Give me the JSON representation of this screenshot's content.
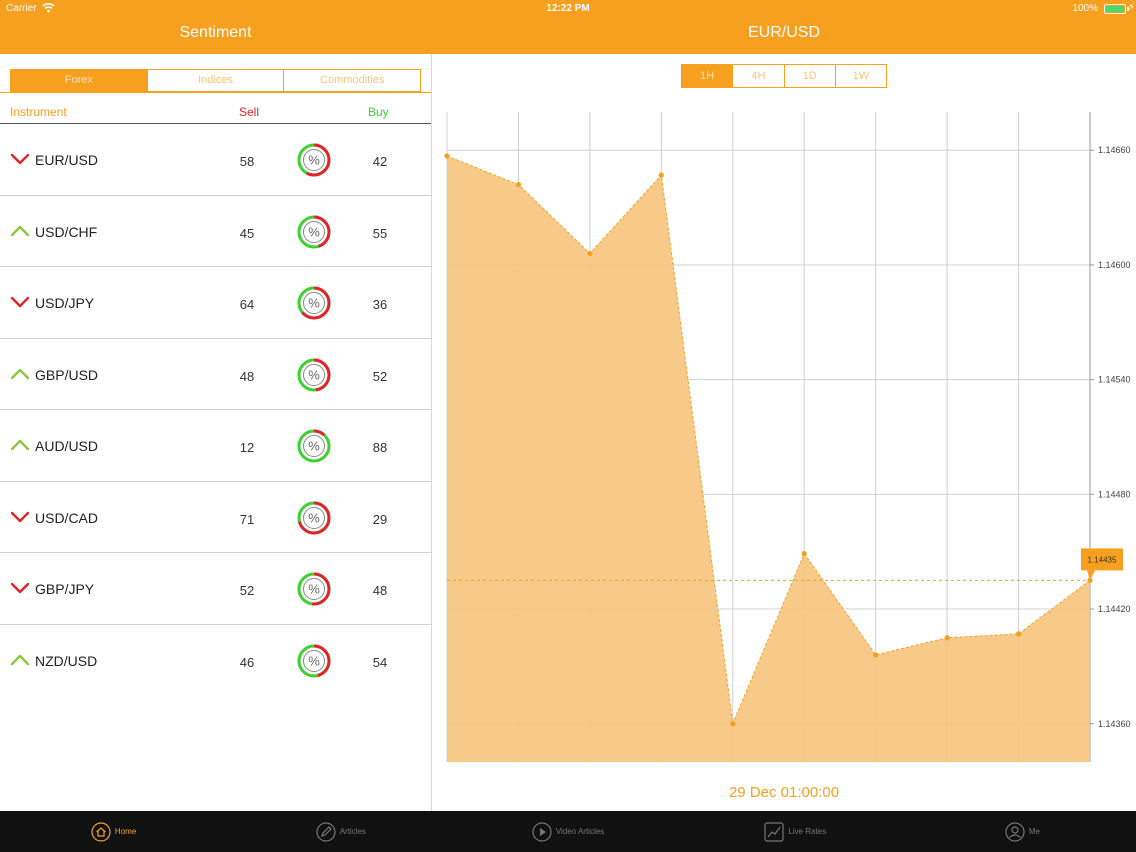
{
  "status": {
    "carrier": "Carrier",
    "time": "12:22 PM",
    "battery": "100%"
  },
  "left_title": "Sentiment",
  "right_title": "EUR/USD",
  "categories": [
    {
      "label": "Forex",
      "active": true
    },
    {
      "label": "Indices",
      "active": false
    },
    {
      "label": "Commodities",
      "active": false
    }
  ],
  "columns": {
    "instrument": "Instrument",
    "sell": "Sell",
    "buy": "Buy"
  },
  "instruments": [
    {
      "name": "EUR/USD",
      "trend": "down",
      "sell": "58",
      "buy": "42"
    },
    {
      "name": "USD/CHF",
      "trend": "up",
      "sell": "45",
      "buy": "55"
    },
    {
      "name": "USD/JPY",
      "trend": "down",
      "sell": "64",
      "buy": "36"
    },
    {
      "name": "GBP/USD",
      "trend": "up",
      "sell": "48",
      "buy": "52"
    },
    {
      "name": "AUD/USD",
      "trend": "up",
      "sell": "12",
      "buy": "88"
    },
    {
      "name": "USD/CAD",
      "trend": "down",
      "sell": "71",
      "buy": "29"
    },
    {
      "name": "GBP/JPY",
      "trend": "down",
      "sell": "52",
      "buy": "48"
    },
    {
      "name": "NZD/USD",
      "trend": "up",
      "sell": "46",
      "buy": "54"
    }
  ],
  "donut_symbol": "%",
  "timeframes": [
    {
      "label": "1H",
      "active": true
    },
    {
      "label": "4H",
      "active": false
    },
    {
      "label": "1D",
      "active": false
    },
    {
      "label": "1W",
      "active": false
    }
  ],
  "chart_data": {
    "type": "area",
    "values": [
      1.14657,
      1.14642,
      1.14606,
      1.14647,
      1.1436,
      1.14449,
      1.14396,
      1.14405,
      1.14407,
      1.14435
    ],
    "ylim": [
      1.1434,
      1.1468
    ],
    "yticks": [
      "1.14660",
      "1.14600",
      "1.14540",
      "1.14480",
      "1.14420",
      "1.14360"
    ],
    "ytick_values": [
      1.1466,
      1.146,
      1.1454,
      1.1448,
      1.1442,
      1.1436
    ],
    "last_label": "1.14435",
    "last_value": 1.14435,
    "grid": true
  },
  "chart_date": "29 Dec 01:00:00",
  "colors": {
    "accent": "#f7a020",
    "sell": "#e0242b",
    "buy": "#3bd12f",
    "up_arrow": "#8dc63f",
    "area": "#f7c680"
  },
  "tabs": [
    {
      "label": "Home",
      "icon": "home-icon",
      "active": true
    },
    {
      "label": "Articles",
      "icon": "pencil-icon",
      "active": false
    },
    {
      "label": "Video Articles",
      "icon": "play-icon",
      "active": false
    },
    {
      "label": "Live Rates",
      "icon": "chart-icon",
      "active": false
    },
    {
      "label": "Me",
      "icon": "user-icon",
      "active": false
    }
  ]
}
